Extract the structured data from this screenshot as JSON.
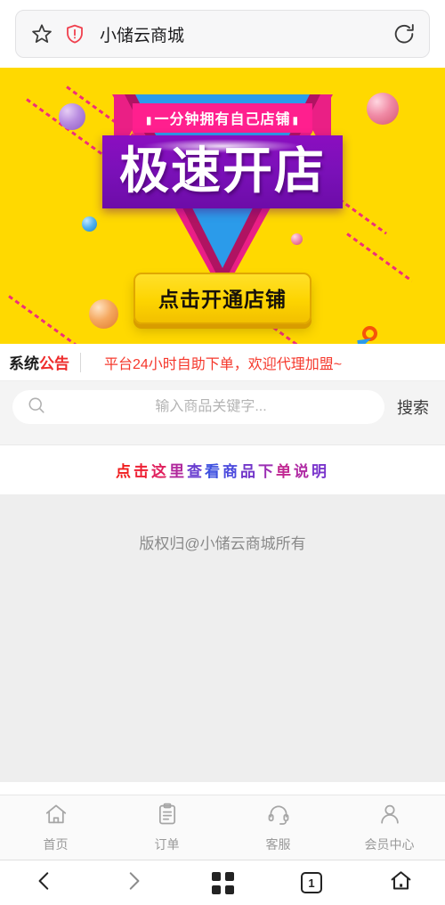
{
  "browser": {
    "title": "小储云商城",
    "star_icon": "star-icon",
    "shield_icon": "security-shield-icon",
    "refresh_icon": "refresh-icon",
    "back_icon": "back-chevron-icon",
    "forward_icon": "forward-chevron-icon",
    "tabs_icon": "grid-icon",
    "tab_count": "1",
    "home_icon": "home-icon"
  },
  "banner": {
    "ribbon": "一分钟拥有自己店铺",
    "headline": "极速开店",
    "cta": "点击开通店铺",
    "colors": {
      "background": "#ffd900",
      "ribbon_pink": "#ff1f8e",
      "headline_purple": "#7a10b8",
      "triangle_blue": "#2b9bea",
      "triangle_crimson": "#b01362",
      "triangle_pink": "#ea1f85",
      "cta_yellow": "#fdd400"
    }
  },
  "notice": {
    "label_black": "系统",
    "label_red": "公告",
    "text": "平台24小时自助下单，欢迎代理加盟~",
    "text_color": "#f5382c"
  },
  "search": {
    "icon": "search-icon",
    "value": "",
    "placeholder": "输入商品关键字...",
    "button": "搜索"
  },
  "link": {
    "chars": [
      {
        "c": "点",
        "color": "#f01c1c"
      },
      {
        "c": "击",
        "color": "#ee1f33"
      },
      {
        "c": "这",
        "color": "#e0215e"
      },
      {
        "c": "里",
        "color": "#b0279c"
      },
      {
        "c": "查",
        "color": "#6b3fd0"
      },
      {
        "c": "看",
        "color": "#3f52e0"
      },
      {
        "c": "商",
        "color": "#4a49dd"
      },
      {
        "c": "品",
        "color": "#7236c9"
      },
      {
        "c": "下",
        "color": "#9b2eb4"
      },
      {
        "c": "单",
        "color": "#c02892"
      },
      {
        "c": "说",
        "color": "#b02ba4"
      },
      {
        "c": "明",
        "color": "#7a35cc"
      }
    ],
    "text": "点击这里查看商品下单说明"
  },
  "footer": {
    "copyright": "版权归@小储云商城所有"
  },
  "tabbar": {
    "items": [
      {
        "label": "首页",
        "icon": "home-icon"
      },
      {
        "label": "订单",
        "icon": "clipboard-icon"
      },
      {
        "label": "客服",
        "icon": "headset-icon"
      },
      {
        "label": "会员中心",
        "icon": "person-icon"
      }
    ]
  }
}
